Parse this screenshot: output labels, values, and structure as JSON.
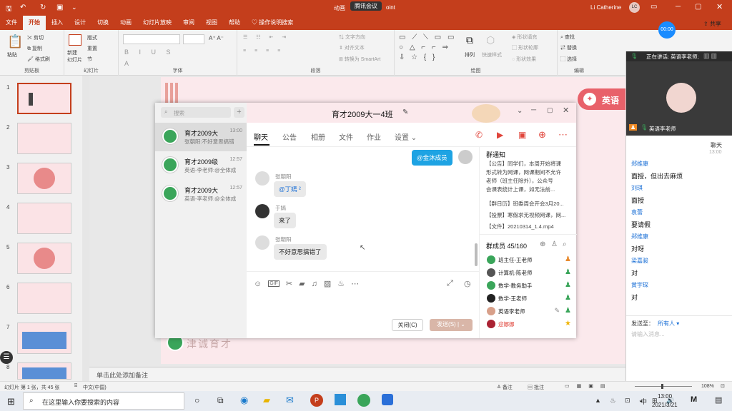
{
  "titlebar": {
    "file_title": "动画",
    "overlay": "腾讯会议",
    "app_suffix": "oint",
    "user": "Li Catherine",
    "user_initials": "LC",
    "timer": "00:00",
    "share": "共享"
  },
  "ribbon_tabs": [
    "文件",
    "开始",
    "插入",
    "设计",
    "切换",
    "动画",
    "幻灯片放映",
    "审阅",
    "视图",
    "帮助",
    "操作说明搜索"
  ],
  "ribbon": {
    "clipboard": {
      "paste": "粘贴",
      "cut": "剪切",
      "copy": "复制",
      "format": "格式刷",
      "label": "剪贴板"
    },
    "slides": {
      "new": "新建\n幻灯片",
      "layout": "版式",
      "reset": "重置",
      "section": "节",
      "label": "幻灯片"
    },
    "font": {
      "label": "字体"
    },
    "paragraph": {
      "text_dir": "文字方向",
      "align_text": "对齐文本",
      "smartart": "转换为 SmartArt",
      "label": "段落"
    },
    "drawing": {
      "arrange": "排列",
      "quick_styles": "快速样式",
      "fill": "形状填充",
      "outline": "形状轮廓",
      "effect": "形状效果",
      "label": "绘图"
    },
    "editing": {
      "find": "查找",
      "replace": "替换",
      "select": "选择",
      "label": "编辑"
    }
  },
  "slides_panel": {
    "numbers": [
      "1",
      "2",
      "3",
      "4",
      "5",
      "6",
      "7",
      "8"
    ]
  },
  "slide": {
    "logo_text": "津诚育才",
    "tw_label": "英语"
  },
  "notes_placeholder": "单击此处添加备注",
  "status": {
    "slide_info": "幻灯片 第 1 张，共 45 张",
    "lang": "中文(中国)",
    "notes": "备注",
    "comments": "批注",
    "zoom": "108%"
  },
  "taskbar": {
    "search_placeholder": "在这里输入你要搜索的内容",
    "time": "13:00",
    "date": "2021/3/21",
    "ime": "中"
  },
  "qq": {
    "search_placeholder": "搜索",
    "conversations": [
      {
        "name": "育才2009大",
        "time": "13:00",
        "msg": "张朝阳:不好意思搞错"
      },
      {
        "name": "育才2009级",
        "time": "12:57",
        "msg": "英语-李老师:@全体成"
      },
      {
        "name": "育才2009大",
        "time": "12:57",
        "msg": "英语-李老师:@全体成"
      }
    ],
    "group_title": "育才2009大一4班",
    "tabs": [
      "聊天",
      "公告",
      "相册",
      "文件",
      "作业",
      "设置"
    ],
    "messages": [
      {
        "sender": "",
        "text": "@金沐成员",
        "self": true
      },
      {
        "sender": "张朝阳",
        "text": "@丁嫣 ²"
      },
      {
        "sender": "于嫣",
        "text": "来了"
      },
      {
        "sender": "张朝阳",
        "text": "不好意思搞错了"
      }
    ],
    "close_btn": "关闭(C)",
    "send_btn": "发送(S)",
    "notice": {
      "title": "群通知",
      "lines": [
        "【公告】同学们，本周开始将课",
        "形式转为网课，网课期间不允许",
        "老师（班主任除外），公众号",
        "会课表统计上课，如无法前...",
        "【群日历】班委周会开会3月20...",
        "【投票】寒假求无视频网课，网...",
        "【文件】20210314_1.4.mp4"
      ]
    },
    "members_title": "群成员 45/160",
    "members": [
      {
        "name": "班主任-王老师",
        "red": false
      },
      {
        "name": "计算机-陈老师",
        "red": false
      },
      {
        "name": "数学-教务助手",
        "red": false
      },
      {
        "name": "数学-王老师",
        "red": false
      },
      {
        "name": "英语李老师",
        "red": false
      },
      {
        "name": "迎娜娜",
        "red": true
      }
    ]
  },
  "zoom_panel": {
    "speaking": "正在讲话: 英语李老师;",
    "video_name": "英语李老师",
    "chat_title": "聊天",
    "time": "13:00",
    "messages": [
      {
        "name": "郑维康",
        "text": "面授，但出去麻烦"
      },
      {
        "name": "刘琪",
        "text": "面授"
      },
      {
        "name": "袁蕾",
        "text": "要请假"
      },
      {
        "name": "郑维康",
        "text": "对呀"
      },
      {
        "name": "梁嘉骏",
        "text": "对"
      },
      {
        "name": "黄宇琛",
        "text": "对"
      }
    ],
    "send_to": "发送至：",
    "send_target": "所有人",
    "input_placeholder": "请输入消息..."
  },
  "colors": {
    "accent": "#c43e1c",
    "qq_blue": "#1ea3e3",
    "zoom_blue": "#1a6fd6",
    "send_btn": "#d9b6a8"
  }
}
